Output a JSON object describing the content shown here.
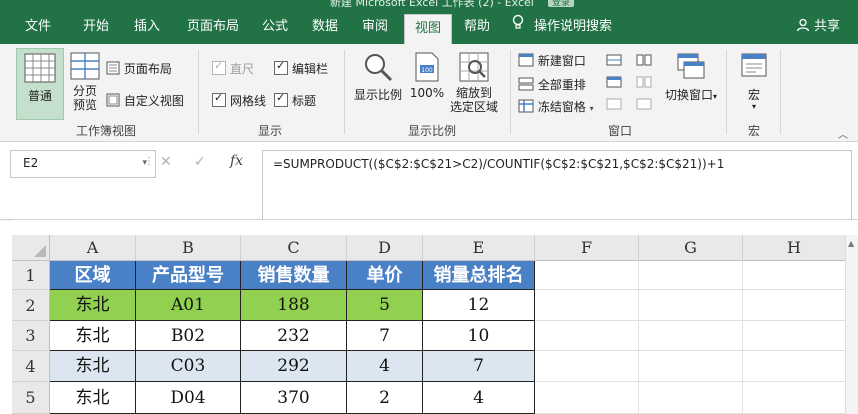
{
  "titlebar": {
    "title": "新建 Microsoft Excel 工作表 (2) - Excel",
    "badge": "登录"
  },
  "tabs": [
    {
      "label": "文件"
    },
    {
      "label": "开始"
    },
    {
      "label": "插入"
    },
    {
      "label": "页面布局"
    },
    {
      "label": "公式"
    },
    {
      "label": "数据"
    },
    {
      "label": "审阅"
    },
    {
      "label": "视图"
    },
    {
      "label": "帮助"
    }
  ],
  "tell_me": "操作说明搜索",
  "share": "共享",
  "ribbon": {
    "workbook_views": {
      "normal": "普通",
      "page_break": "分页\n预览",
      "page_layout": "页面布局",
      "custom_views": "自定义视图",
      "label": "工作簿视图"
    },
    "show": {
      "ruler": "直尺",
      "formula_bar": "编辑栏",
      "gridlines": "网格线",
      "headings": "标题",
      "label": "显示"
    },
    "zoom": {
      "zoom": "显示比例",
      "zoom100": "100%",
      "zoom_selection": "缩放到\n选定区域",
      "label": "显示比例"
    },
    "window": {
      "new_window": "新建窗口",
      "arrange_all": "全部重排",
      "freeze_panes": "冻结窗格",
      "switch": "切换窗口",
      "label": "窗口"
    },
    "macros": {
      "macros": "宏",
      "label": "宏"
    }
  },
  "formula_bar": {
    "name_box": "E2",
    "formula": "=SUMPRODUCT(($C$2:$C$21>C2)/COUNTIF($C$2:$C$21,$C$2:$C$21))+1",
    "fx": "fx"
  },
  "columns": [
    "A",
    "B",
    "C",
    "D",
    "E",
    "F",
    "G",
    "H"
  ],
  "rows": [
    "1",
    "2",
    "3",
    "4",
    "5"
  ],
  "table": {
    "header": [
      "区域",
      "产品型号",
      "销售数量",
      "单价",
      "销量总排名"
    ],
    "data": [
      [
        "东北",
        "A01",
        "188",
        "5",
        "12"
      ],
      [
        "东北",
        "B02",
        "232",
        "7",
        "10"
      ],
      [
        "东北",
        "C03",
        "292",
        "4",
        "7"
      ],
      [
        "东北",
        "D04",
        "370",
        "2",
        "4"
      ]
    ]
  },
  "colors": {
    "excel_green": "#217346",
    "header_blue": "#4a80c6",
    "highlight_green": "#92d050",
    "band_blue": "#dce6f1"
  }
}
